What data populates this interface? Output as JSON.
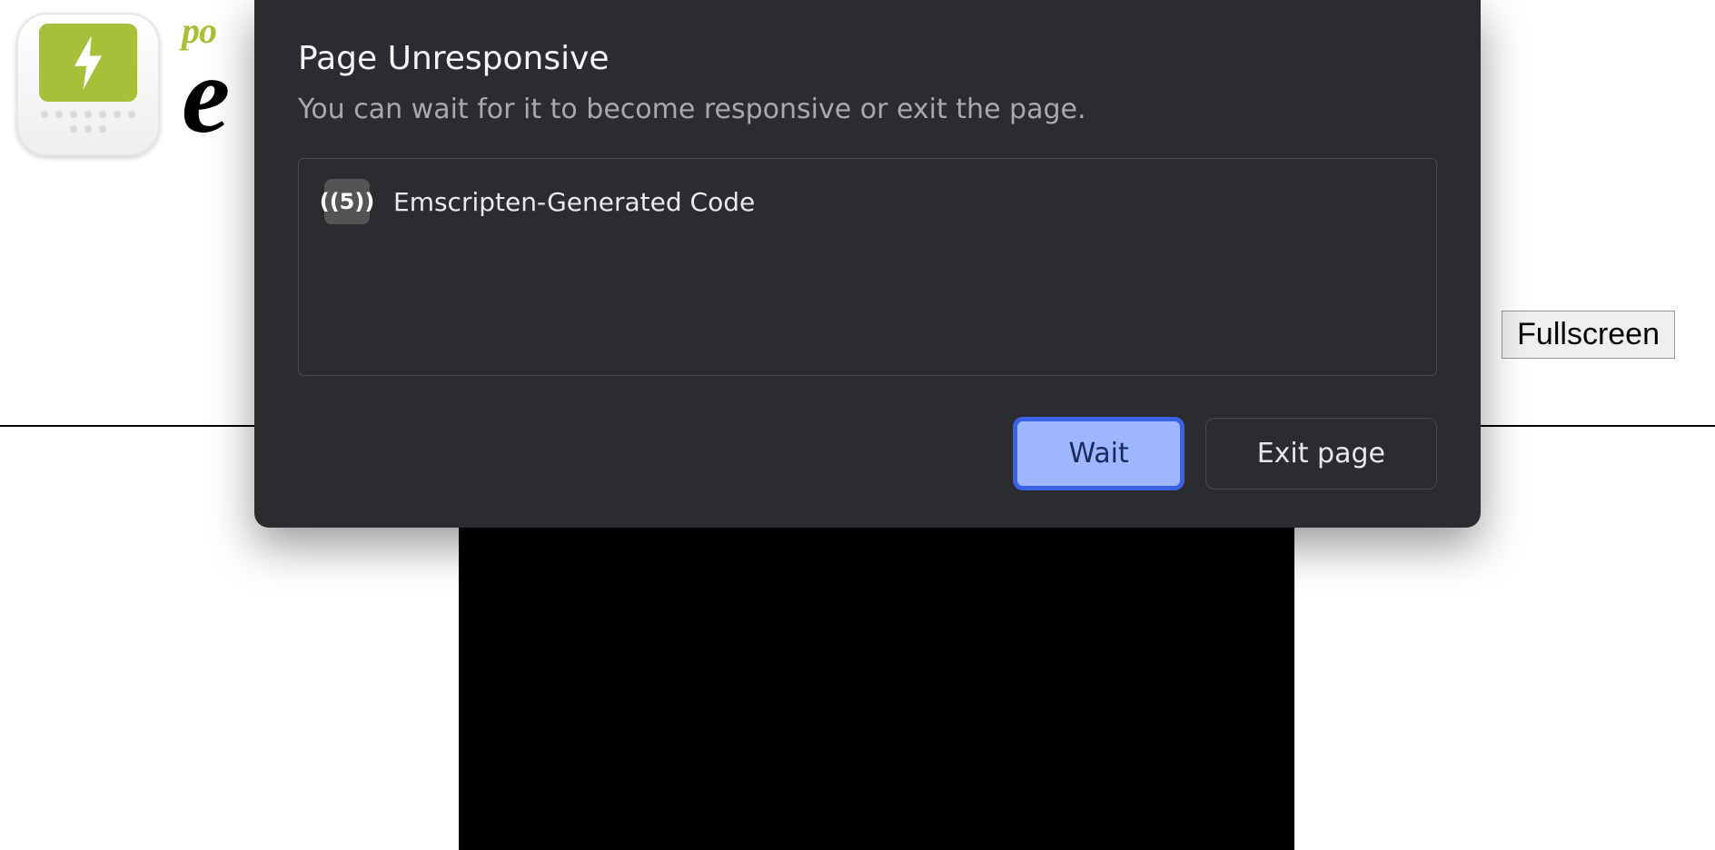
{
  "page": {
    "logo_subtitle": "po",
    "logo_main": "e",
    "fullscreen_label": "Fullscreen"
  },
  "dialog": {
    "title": "Page Unresponsive",
    "message": "You can wait for it to become responsive or exit the page.",
    "items": [
      {
        "favicon_text": "((5))",
        "label": "Emscripten-Generated Code"
      }
    ],
    "primary_button": "Wait",
    "secondary_button": "Exit page"
  }
}
